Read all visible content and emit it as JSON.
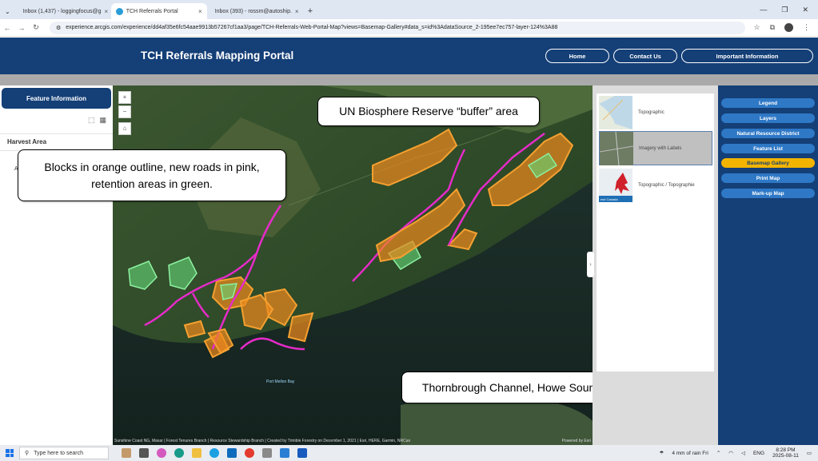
{
  "browser": {
    "tabs": [
      {
        "label": "Inbox (1,437) - loggingfocus@g",
        "icon": "gmail-icon"
      },
      {
        "label": "TCH Referrals Portal",
        "icon": "arcgis-icon"
      },
      {
        "label": "Inbox (393) - rossm@autoship.",
        "icon": "gmail-icon"
      }
    ],
    "url": "experience.arcgis.com/experience/dd4af35e6fc54aae9913b57267cf1aa3/page/TCH-Referrals-Web-Portal-Map?views=Basemap-Gallery#data_s=id%3AdataSource_2-195ee7ec757-layer-124%3A88"
  },
  "header": {
    "title": "TCH Referrals Mapping Portal",
    "buttons": [
      "Home",
      "Contact Us",
      "Important Information"
    ]
  },
  "left_panel": {
    "title": "Feature Information",
    "section": "Harvest Area",
    "truncated_value": "A"
  },
  "map": {
    "callouts": {
      "top": "UN Biosphere Reserve “buffer” area",
      "left": "Blocks in orange outline, new roads in pink, retention areas in green.",
      "bottom": "Thornbrough Channel, Howe Sound"
    },
    "place_label": "Port Mellon Bay",
    "credits": "Sunshine Coast NG, Maxar | Forest Tenures Branch | Resource Stewardship Branch | Created by Trimble Forestry on December 1, 2021 | Esri, HERE, Garmin, NRCan",
    "powered_by": "Powered by Esri",
    "zoom_in": "+",
    "zoom_out": "−",
    "home": "⌂"
  },
  "basemap_gallery": {
    "items": [
      {
        "label": "Topographic",
        "selected": false
      },
      {
        "label": "Imagery with Labels",
        "selected": true
      },
      {
        "label": "Topographic / Topographie",
        "selected": false
      }
    ],
    "thumb_logo_text": "esri Canada"
  },
  "right_panel": {
    "buttons": [
      "Legend",
      "Layers",
      "Natural Resource District",
      "Feature List",
      "Basemap Gallery",
      "Print Map",
      "Mark-up Map"
    ],
    "active": "Basemap Gallery"
  },
  "taskbar": {
    "search_placeholder": "Type here to search",
    "weather": "4 mm of rain Fri",
    "language": "ENG",
    "time": "8:28 PM",
    "date": "2025-08-11"
  },
  "colors": {
    "header_blue": "#143f77",
    "button_blue": "#2e78c6",
    "active_yellow": "#f3b400",
    "harvest_orange": "#f08a1c",
    "road_pink": "#e52bc8",
    "retention_green": "#66d97a"
  }
}
